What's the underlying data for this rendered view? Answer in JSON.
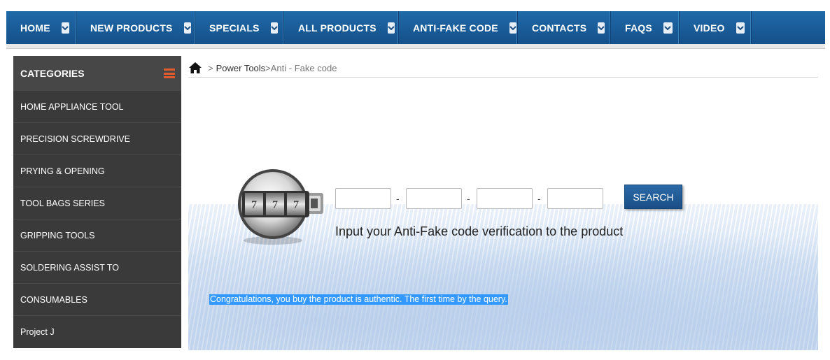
{
  "nav": {
    "items": [
      {
        "label": "HOME"
      },
      {
        "label": "NEW PRODUCTS"
      },
      {
        "label": "SPECIALS"
      },
      {
        "label": "ALL PRODUCTS"
      },
      {
        "label": "ANTI-FAKE CODE"
      },
      {
        "label": "CONTACTS"
      },
      {
        "label": "FAQS"
      },
      {
        "label": "VIDEO"
      }
    ],
    "color": "#1f6aa8"
  },
  "sidebar": {
    "title": "CATEGORIES",
    "items": [
      {
        "label": "HOME APPLIANCE TOOL"
      },
      {
        "label": "PRECISION SCREWDRIVE"
      },
      {
        "label": "PRYING & OPENING"
      },
      {
        "label": "TOOL BAGS SERIES"
      },
      {
        "label": "GRIPPING TOOLS"
      },
      {
        "label": "SOLDERING ASSIST TO"
      },
      {
        "label": "CONSUMABLES"
      },
      {
        "label": "Project J"
      }
    ],
    "accent": "#e35a2b"
  },
  "breadcrumb": {
    "sep": ">",
    "link": "Power Tools",
    "current": "Anti - Fake code"
  },
  "antifake": {
    "dash": "-",
    "search_label": "SEARCH",
    "hint": "Input your Anti-Fake code verification to the product",
    "result": "Congratulations, you buy the product is authentic. The first time by the query.",
    "lock_digits": [
      "7",
      "7",
      "7"
    ]
  }
}
